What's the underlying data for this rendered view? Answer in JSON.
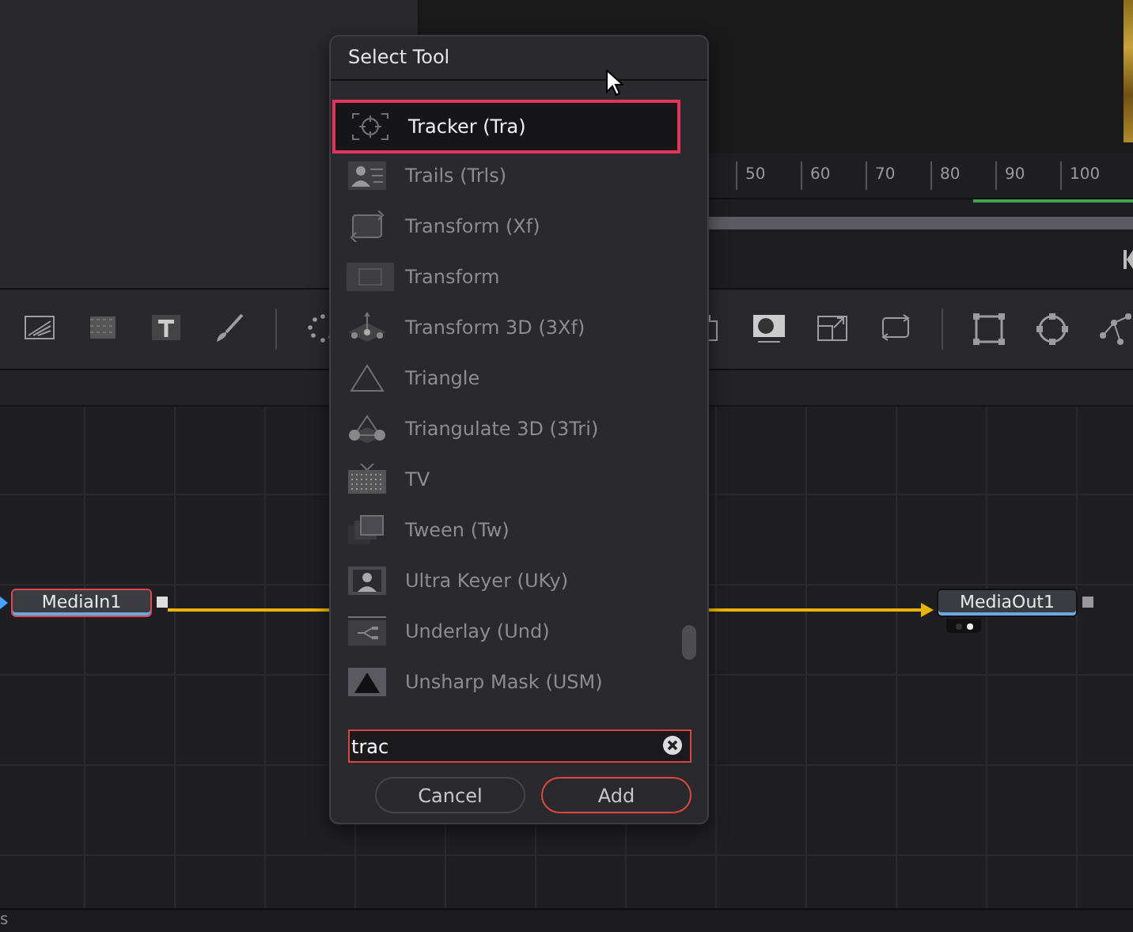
{
  "timeline": {
    "ruler_ticks": [
      "50",
      "60",
      "70",
      "80",
      "90",
      "100"
    ]
  },
  "node_editor": {
    "nodes": [
      {
        "name": "MediaIn1",
        "selected": true,
        "kind": "input"
      },
      {
        "name": "MediaOut1",
        "selected": false,
        "kind": "output"
      }
    ]
  },
  "dialog": {
    "title": "Select Tool",
    "items": [
      {
        "label": "Tracker (Tra)",
        "selected": true
      },
      {
        "label": "Trails (Trls)",
        "selected": false
      },
      {
        "label": "Transform (Xf)",
        "selected": false
      },
      {
        "label": "Transform",
        "selected": false
      },
      {
        "label": "Transform 3D (3Xf)",
        "selected": false
      },
      {
        "label": "Triangle",
        "selected": false
      },
      {
        "label": "Triangulate 3D (3Tri)",
        "selected": false
      },
      {
        "label": "TV",
        "selected": false
      },
      {
        "label": "Tween (Tw)",
        "selected": false
      },
      {
        "label": "Ultra Keyer (UKy)",
        "selected": false
      },
      {
        "label": "Underlay (Und)",
        "selected": false
      },
      {
        "label": "Unsharp Mask (USM)",
        "selected": false
      }
    ],
    "search": {
      "value": "trac"
    },
    "buttons": [
      {
        "label": "Cancel",
        "kind": "secondary"
      },
      {
        "label": "Add",
        "kind": "primary"
      }
    ]
  },
  "status_bar": {
    "text": "s"
  }
}
